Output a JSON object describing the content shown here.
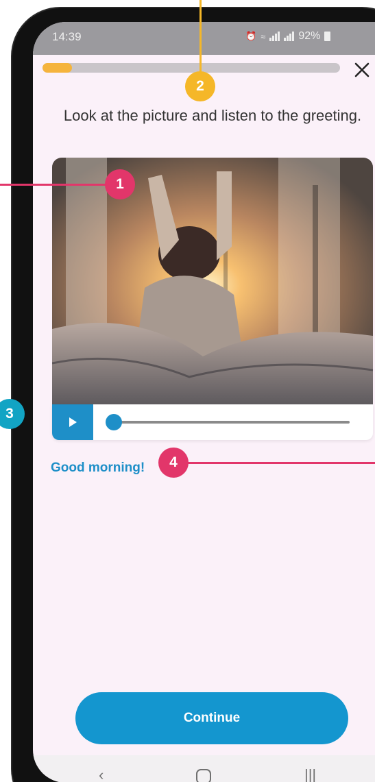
{
  "status_bar": {
    "time": "14:39",
    "battery": "92%"
  },
  "lesson": {
    "progress_fraction": 0.1,
    "close_icon": "close-icon",
    "instruction": "Look at the picture and listen to the greeting.",
    "image_description_icon": "photo-woman-stretching-in-bed",
    "audio_progress_fraction": 0.03,
    "greeting_text": "Good morning!",
    "continue_label": "Continue"
  },
  "callouts": {
    "photo": "1",
    "progress": "2",
    "play": "3",
    "text": "4"
  },
  "colors": {
    "accent_blue": "#1e8fc8",
    "progress_yellow": "#f5b43d",
    "callout_pink": "#e2366a",
    "callout_yellow": "#f5b728",
    "callout_teal": "#12a4c4",
    "screen_bg": "#fbf1f9"
  },
  "nav_bar": {
    "back_icon": "back-icon",
    "home_icon": "home-icon",
    "recents_icon": "recents-icon"
  }
}
